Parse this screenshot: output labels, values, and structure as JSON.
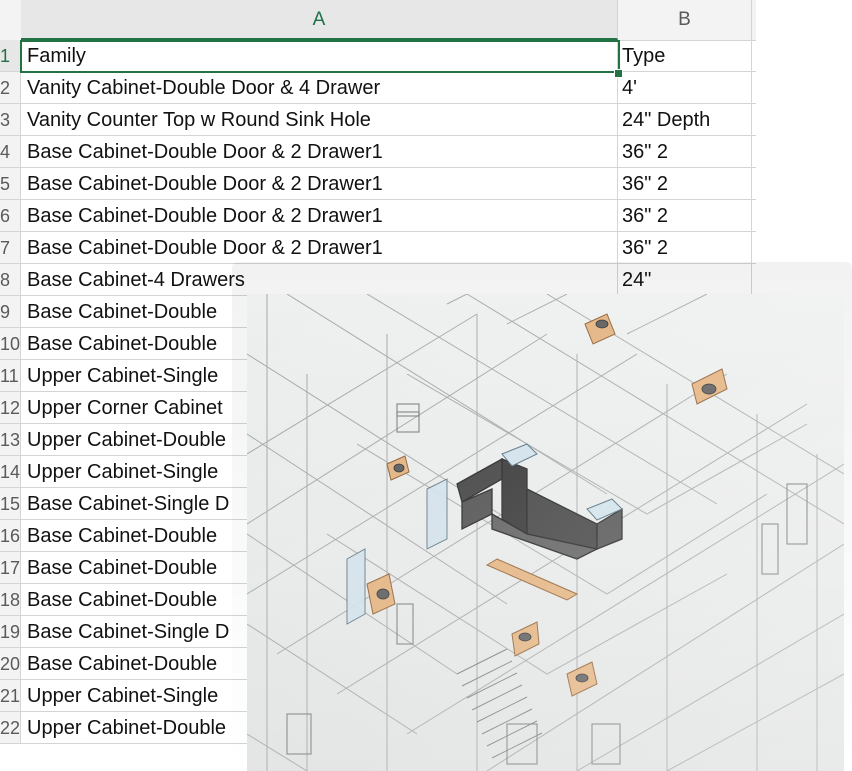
{
  "columns": {
    "a": "A",
    "b": "B"
  },
  "rows": [
    {
      "num": "1",
      "family": "Family",
      "type": "Type"
    },
    {
      "num": "2",
      "family": "Vanity Cabinet-Double Door & 4 Drawer",
      "type": "4'"
    },
    {
      "num": "3",
      "family": "Vanity Counter Top w Round Sink Hole",
      "type": "24\" Depth"
    },
    {
      "num": "4",
      "family": "Base Cabinet-Double Door & 2 Drawer1",
      "type": "36\" 2"
    },
    {
      "num": "5",
      "family": "Base Cabinet-Double Door & 2 Drawer1",
      "type": "36\" 2"
    },
    {
      "num": "6",
      "family": "Base Cabinet-Double Door & 2 Drawer1",
      "type": "36\" 2"
    },
    {
      "num": "7",
      "family": "Base Cabinet-Double Door & 2 Drawer1",
      "type": "36\" 2"
    },
    {
      "num": "8",
      "family": "Base Cabinet-4 Drawers",
      "type": "24\""
    },
    {
      "num": "9",
      "family": "Base Cabinet-Double",
      "type": ""
    },
    {
      "num": "10",
      "family": "Base Cabinet-Double",
      "type": ""
    },
    {
      "num": "11",
      "family": "Upper Cabinet-Single",
      "type": ""
    },
    {
      "num": "12",
      "family": "Upper Corner Cabinet",
      "type": ""
    },
    {
      "num": "13",
      "family": "Upper Cabinet-Double",
      "type": ""
    },
    {
      "num": "14",
      "family": "Upper Cabinet-Single",
      "type": ""
    },
    {
      "num": "15",
      "family": "Base Cabinet-Single D",
      "type": ""
    },
    {
      "num": "16",
      "family": "Base Cabinet-Double",
      "type": ""
    },
    {
      "num": "17",
      "family": "Base Cabinet-Double",
      "type": ""
    },
    {
      "num": "18",
      "family": "Base Cabinet-Double",
      "type": ""
    },
    {
      "num": "19",
      "family": "Base Cabinet-Single D",
      "type": ""
    },
    {
      "num": "20",
      "family": "Base Cabinet-Double",
      "type": ""
    },
    {
      "num": "21",
      "family": "Upper Cabinet-Single",
      "type": ""
    },
    {
      "num": "22",
      "family": "Upper Cabinet-Double",
      "type": ""
    }
  ],
  "colors": {
    "selection": "#217346",
    "header_bg": "#f3f3f3",
    "gridline": "#d4d4d4",
    "cabinet_wood": "#e8b27a",
    "cabinet_dark": "#3a3a3a"
  },
  "overlay": {
    "icon": "3d-model-image"
  }
}
